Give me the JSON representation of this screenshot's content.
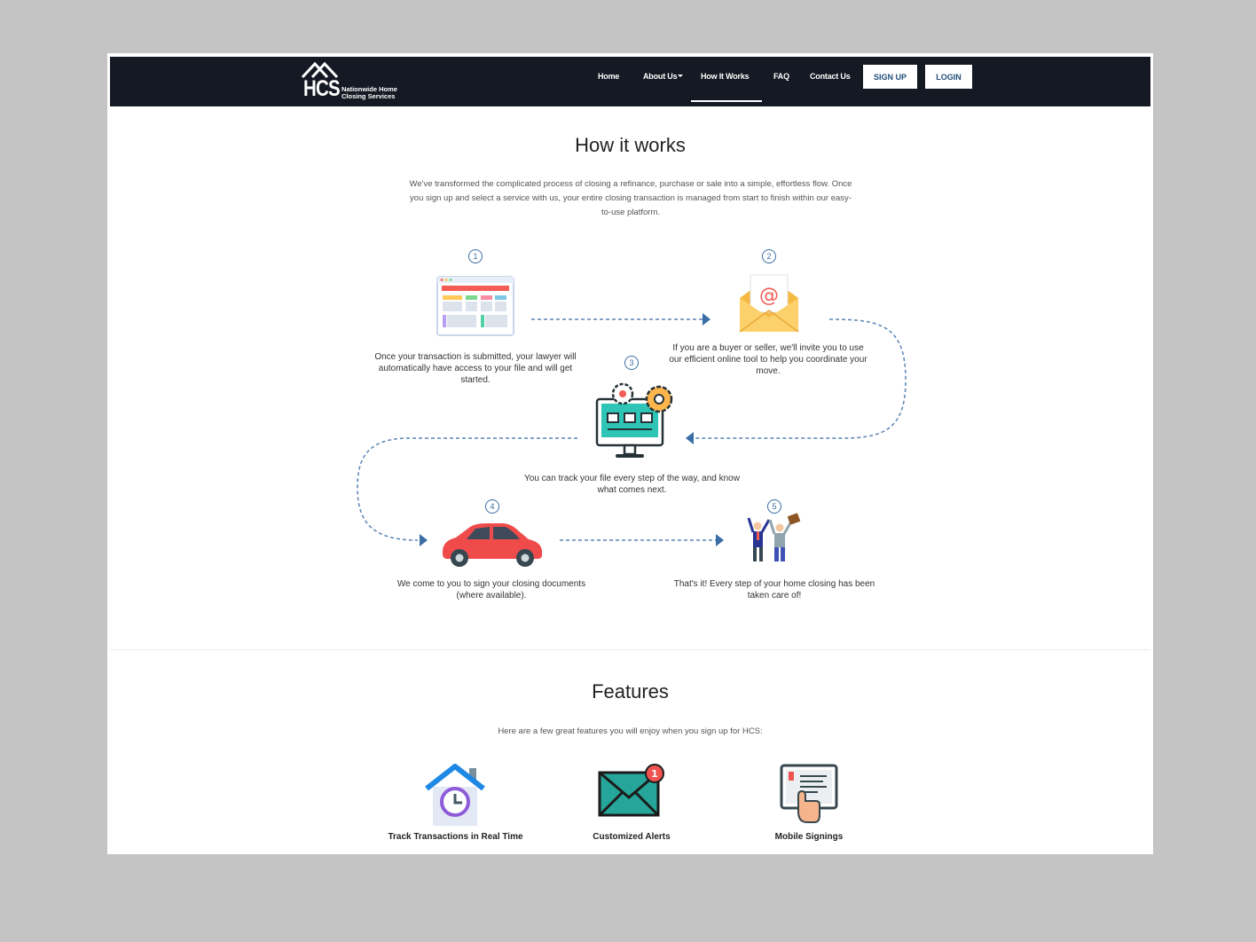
{
  "brand": {
    "logo_letters": "HCS",
    "logo_line1": "Nationwide Home",
    "logo_line2": "Closing Services"
  },
  "nav": {
    "home": "Home",
    "about": "About Us",
    "how": "How It Works",
    "faq": "FAQ",
    "contact": "Contact Us",
    "signup": "SIGN UP",
    "login": "LOGIN",
    "active": "How It Works"
  },
  "how": {
    "title": "How it works",
    "intro": "We've transformed the complicated process of closing a refinance, purchase or sale into a simple, effortless flow. Once you sign up and select a service with us, your entire closing transaction is managed from start to finish within our easy-to-use platform.",
    "steps": [
      {
        "num": "1",
        "icon": "browser-dashboard-icon",
        "text": "Once your transaction is submitted, your lawyer will automatically have access to your file and will get started."
      },
      {
        "num": "2",
        "icon": "email-envelope-icon",
        "text": "If you are a buyer or seller, we'll invite you to use our efficient online tool to help you coordinate your move."
      },
      {
        "num": "3",
        "icon": "monitor-gears-icon",
        "text": "You can track your file every step of the way, and know what comes next."
      },
      {
        "num": "4",
        "icon": "red-car-icon",
        "text": "We come to you to sign your closing documents (where available)."
      },
      {
        "num": "5",
        "icon": "celebrating-people-icon",
        "text": "That's it! Every step of your home closing has been taken care of!"
      }
    ]
  },
  "features": {
    "title": "Features",
    "subtitle": "Here are a few great features you will enjoy when you sign up for HCS:",
    "items": [
      {
        "label": "Track Transactions in Real Time",
        "icon": "house-clock-icon"
      },
      {
        "label": "Customized Alerts",
        "icon": "alert-envelope-icon"
      },
      {
        "label": "Mobile Signings",
        "icon": "tablet-touch-icon"
      }
    ],
    "alert_badge": "1"
  },
  "colors": {
    "navbar": "#151923",
    "accent": "#3a6ea5",
    "button_text": "#1f4e79"
  }
}
